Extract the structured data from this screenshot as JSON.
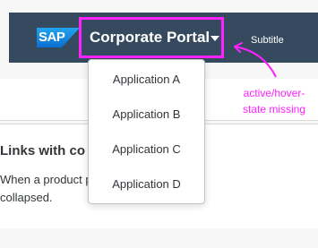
{
  "shellbar": {
    "logo_text": "SAP",
    "title": "Corporate Portal",
    "subtitle": "Subtitle"
  },
  "card": {
    "heading": "Links with co           CoPilot and Prod",
    "body_line1": "When a product                  product links should",
    "body_line2": "collapsed."
  },
  "menu": {
    "items": [
      {
        "label": "Application A"
      },
      {
        "label": "Application B"
      },
      {
        "label": "Application C"
      },
      {
        "label": "Application D"
      }
    ]
  },
  "annotation": {
    "line1": "active/hover-",
    "line2": "state missing",
    "color": "#ff21ff"
  },
  "colors": {
    "shellbar_bg": "#354a5f",
    "sap_blue": "#0a6ed1",
    "annotation": "#ff21ff"
  }
}
